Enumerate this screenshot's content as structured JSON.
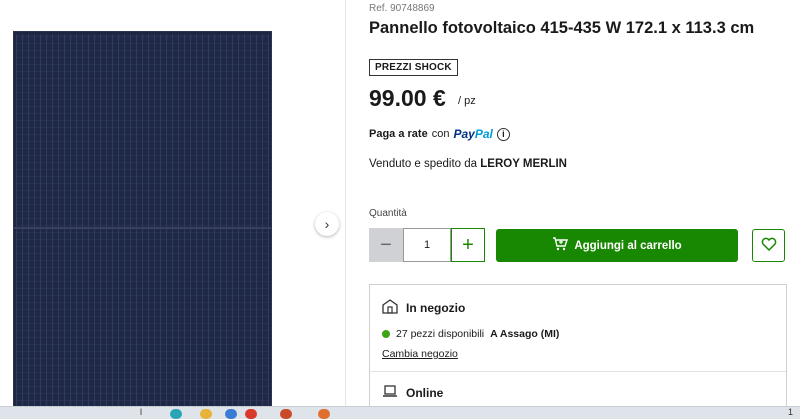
{
  "product": {
    "ref": "Ref. 90748869",
    "title": "Pannello fotovoltaico 415-435 W 172.1 x 113.3 cm",
    "badge": "PREZZI SHOCK",
    "price": "99.00 €",
    "unit": "/ pz",
    "rate_label": "Paga a rate",
    "rate_with": "con",
    "paypal_part1": "Pay",
    "paypal_part2": "Pal",
    "seller_prefix": "Venduto e spedito da",
    "seller_name": "LEROY MERLIN"
  },
  "quantity": {
    "label": "Quantità",
    "value": "1",
    "minus": "−",
    "plus": "+"
  },
  "actions": {
    "add_to_cart": "Aggiungi al carrello"
  },
  "store": {
    "heading": "In negozio",
    "availability": "27 pezzi disponibili",
    "location": "A Assago (MI)",
    "change_link": "Cambia negozio",
    "online_heading": "Online"
  },
  "icons": {
    "gallery_next": "chevron-right-icon",
    "info": "info-icon",
    "cart": "cart-icon",
    "heart": "heart-icon",
    "store": "store-icon",
    "truck": "laptop-icon"
  },
  "colors": {
    "accent": "#188803",
    "available": "#3ca314",
    "panel": "#1d2540"
  },
  "taskbar": {
    "left_text": "l",
    "right_text": "1"
  }
}
